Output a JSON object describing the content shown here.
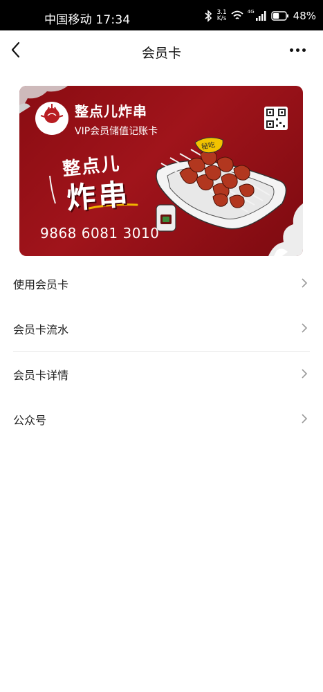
{
  "status_bar": {
    "carrier_time": "中国移动 17:34",
    "net_speed_value": "3.1",
    "net_speed_unit": "K/s",
    "network_type": "4G",
    "battery": "48%",
    "battery_level": 0.48
  },
  "nav": {
    "title": "会员卡",
    "back_icon": "back-arrow-icon",
    "more_icon": "more-icon"
  },
  "card": {
    "brand_name": "整点儿炸串",
    "subtitle": "VIP会员储值记账卡",
    "card_number": "9868 6081 3010",
    "art_title_top": "整点儿",
    "art_title_main": "炸串",
    "art_tag": "秘吃",
    "logo_text": "整点儿炸串",
    "background_color": "#9a1218"
  },
  "menu": {
    "items": [
      {
        "label": "使用会员卡"
      },
      {
        "label": "会员卡流水"
      },
      {
        "label": "会员卡详情"
      },
      {
        "label": "公众号"
      }
    ]
  }
}
